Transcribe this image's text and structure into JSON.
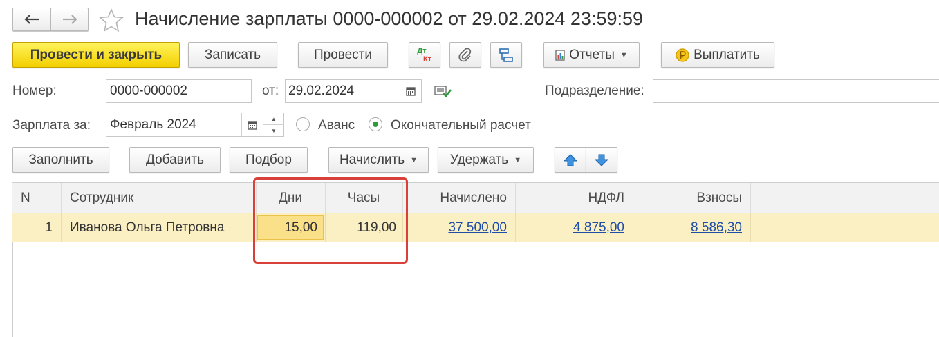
{
  "window": {
    "title": "Начисление зарплаты 0000-000002 от 29.02.2024 23:59:59"
  },
  "toolbar": {
    "post_close_label": "Провести и закрыть",
    "save_label": "Записать",
    "post_label": "Провести",
    "dt_label": "Дт",
    "kt_label": "Кт",
    "reports_label": "Отчеты",
    "pay_label": "Выплатить"
  },
  "form": {
    "number_label": "Номер:",
    "number_value": "0000-000002",
    "date_label": "от:",
    "date_value": "29.02.2024",
    "department_label": "Подразделение:",
    "department_value": "",
    "period_label": "Зарплата за:",
    "period_value": "Февраль 2024",
    "radio_advance_label": "Аванс",
    "radio_final_label": "Окончательный расчет",
    "radio_selected": "final"
  },
  "table_toolbar": {
    "fill_label": "Заполнить",
    "add_label": "Добавить",
    "select_label": "Подбор",
    "accrue_label": "Начислить",
    "withhold_label": "Удержать"
  },
  "table": {
    "columns": [
      "N",
      "Сотрудник",
      "Дни",
      "Часы",
      "Начислено",
      "НДФЛ",
      "Взносы"
    ],
    "rows": [
      {
        "n": "1",
        "employee": "Иванова Ольга Петровна",
        "days": "15,00",
        "hours": "119,00",
        "accrued": "37 500,00",
        "ndfl": "4 875,00",
        "contributions": "8 586,30"
      }
    ]
  },
  "colors": {
    "primary_button": "#f5d400",
    "highlight_frame": "#d9403a",
    "row_selected": "#fbefc4",
    "link": "#1f4ea8",
    "accent_blue": "#2f86d8"
  }
}
